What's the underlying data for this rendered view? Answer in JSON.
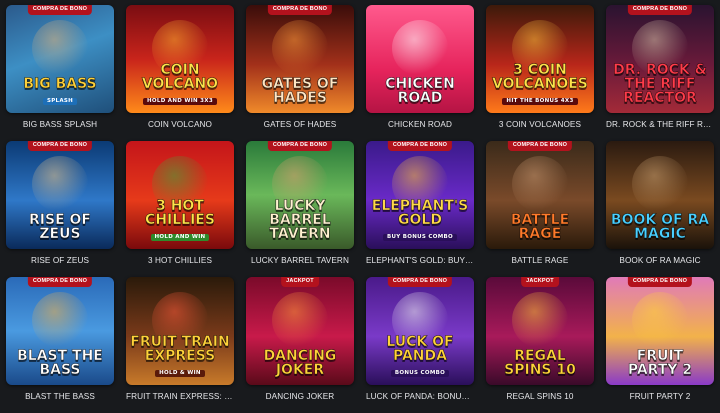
{
  "games": [
    {
      "title": "BIG BASS SPLASH",
      "badge": "COMPRA DE BONO",
      "logo": "BIG BASS",
      "sub": "SPLASH",
      "bg": "linear-gradient(160deg,#2b5a8c 0%,#3d8fc4 45%,#1f4f7a 100%)",
      "fig": "#e0b27a",
      "logo_color": "#ffd23a",
      "sub_bg": "#1d6fb8"
    },
    {
      "title": "COIN VOLCANO",
      "badge": "",
      "logo": "COIN VOLCANO",
      "sub": "HOLD and WIN 3x3",
      "bg": "linear-gradient(180deg,#7a0d12 0%,#c8241b 50%,#ff8a1a 100%)",
      "fig": "#ffb02e",
      "logo_color": "#ffe34a",
      "sub_bg": "#5a0a0c"
    },
    {
      "title": "GATES OF HADES",
      "badge": "COMPRA DE BONO",
      "logo": "GATES OF HADES",
      "sub": "",
      "bg": "linear-gradient(180deg,#3a0d0a 0%,#a2301a 55%,#f08a2a 100%)",
      "fig": "#ff9d3a",
      "logo_color": "#ffe6c4",
      "sub_bg": "transparent"
    },
    {
      "title": "CHICKEN ROAD",
      "badge": "",
      "logo": "CHICKEN ROAD",
      "sub": "",
      "bg": "linear-gradient(180deg,#ff5a8d 0%,#e6245c 60%,#b51444 100%)",
      "fig": "#ffffff",
      "logo_color": "#ffffff",
      "sub_bg": "transparent"
    },
    {
      "title": "3 COIN VOLCANOES",
      "badge": "",
      "logo": "3 COIN VOLCANOES",
      "sub": "HIT the BONUS 4x3",
      "bg": "linear-gradient(180deg,#3d1a0a 0%,#b8261a 55%,#ff7a1a 100%)",
      "fig": "#ffc23a",
      "logo_color": "#ffe34a",
      "sub_bg": "#5a0a0c"
    },
    {
      "title": "DR. ROCK & THE RIFF REACTOR",
      "badge": "COMPRA DE BONO",
      "logo": "DR. ROCK & THE RIFF REACTOR",
      "sub": "",
      "bg": "linear-gradient(180deg,#2a1330 0%,#6a1a3a 55%,#a32a38 100%)",
      "fig": "#d9c2a8",
      "logo_color": "#ff3b4a",
      "sub_bg": "transparent"
    },
    {
      "title": "RISE OF ZEUS",
      "badge": "COMPRA DE BONO",
      "logo": "RISE OF ZEUS",
      "sub": "",
      "bg": "linear-gradient(180deg,#0b3a74 0%,#2f78c8 55%,#0a2a5a 100%)",
      "fig": "#e8c48a",
      "logo_color": "#ffffff",
      "sub_bg": "transparent"
    },
    {
      "title": "3 HOT CHILLIES",
      "badge": "",
      "logo": "3 HOT CHILLIES",
      "sub": "HOLD AND WIN",
      "bg": "linear-gradient(180deg,#c4151a 0%,#e63a1a 55%,#7a0a0c 100%)",
      "fig": "#3fa83a",
      "logo_color": "#ffe34a",
      "sub_bg": "#2f8a2a"
    },
    {
      "title": "LUCKY BARREL TAVERN",
      "badge": "COMPRA DE BONO",
      "logo": "LUCKY BARREL TAVERN",
      "sub": "",
      "bg": "linear-gradient(180deg,#2a7a3a 0%,#6ab85a 50%,#3a5a2a 100%)",
      "fig": "#e2a070",
      "logo_color": "#fff2d0",
      "sub_bg": "transparent"
    },
    {
      "title": "ELEPHANT'S GOLD: BUY BONU...",
      "badge": "COMPRA DE BONO",
      "logo": "ELEPHANT'S GOLD",
      "sub": "BUY BONUS COMBO",
      "bg": "linear-gradient(180deg,#3a1a8a 0%,#6a2ac8 55%,#2a0f5a 100%)",
      "fig": "#ffc23a",
      "logo_color": "#ffd94a",
      "sub_bg": "#2a0f5a"
    },
    {
      "title": "BATTLE RAGE",
      "badge": "COMPRA DE BONO",
      "logo": "BATTLE RAGE",
      "sub": "",
      "bg": "linear-gradient(180deg,#3a2a1a 0%,#7a4a2a 55%,#2a1a0a 100%)",
      "fig": "#c99870",
      "logo_color": "#ff7a2a",
      "sub_bg": "transparent"
    },
    {
      "title": "BOOK OF RA MAGIC",
      "badge": "",
      "logo": "BOOK OF RA MAGIC",
      "sub": "",
      "bg": "linear-gradient(180deg,#2a1a10 0%,#7a4a20 55%,#1a120a 100%)",
      "fig": "#c9a070",
      "logo_color": "#4ad0ff",
      "sub_bg": "transparent"
    },
    {
      "title": "BLAST THE BASS",
      "badge": "COMPRA DE BONO",
      "logo": "BLAST THE BASS",
      "sub": "",
      "bg": "linear-gradient(180deg,#2a6ab8 0%,#4a9ae0 50%,#1a4a8a 100%)",
      "fig": "#f2b24a",
      "logo_color": "#ffffff",
      "sub_bg": "transparent"
    },
    {
      "title": "FRUIT TRAIN EXPRESS: HOLD ...",
      "badge": "",
      "logo": "FRUIT TRAIN EXPRESS",
      "sub": "HOLD & WIN",
      "bg": "linear-gradient(180deg,#2a1a0a 0%,#7a3a1a 55%,#c87a2a 100%)",
      "fig": "#ff5a3a",
      "logo_color": "#ffd23a",
      "sub_bg": "#5a1a0a"
    },
    {
      "title": "DANCING JOKER",
      "badge": "JACKPOT",
      "logo": "DANCING JOKER",
      "sub": "",
      "bg": "linear-gradient(180deg,#7a0a2a 0%,#c81a4a 55%,#5a0a1a 100%)",
      "fig": "#ff9a3a",
      "logo_color": "#ffd23a",
      "sub_bg": "transparent"
    },
    {
      "title": "LUCK OF PANDA: BONUS COMBO",
      "badge": "COMPRA DE BONO",
      "logo": "LUCK OF PANDA",
      "sub": "BONUS COMBO",
      "bg": "linear-gradient(180deg,#4a1a8a 0%,#7a3ac8 55%,#2a0f5a 100%)",
      "fig": "#f2f2f2",
      "logo_color": "#ffd23a",
      "sub_bg": "#2a0f5a"
    },
    {
      "title": "REGAL SPINS 10",
      "badge": "JACKPOT",
      "logo": "REGAL SPINS 10",
      "sub": "",
      "bg": "linear-gradient(180deg,#5a0a3a 0%,#a81a5a 55%,#3a0a2a 100%)",
      "fig": "#ffc23a",
      "logo_color": "#ffd23a",
      "sub_bg": "transparent"
    },
    {
      "title": "FRUIT PARTY 2",
      "badge": "COMPRA DE BONO",
      "logo": "FRUIT PARTY 2",
      "sub": "",
      "bg": "linear-gradient(180deg,#e07ab8 0%,#f2b24a 55%,#8a3ac8 100%)",
      "fig": "#ffd23a",
      "logo_color": "#ffffff",
      "sub_bg": "transparent"
    }
  ]
}
